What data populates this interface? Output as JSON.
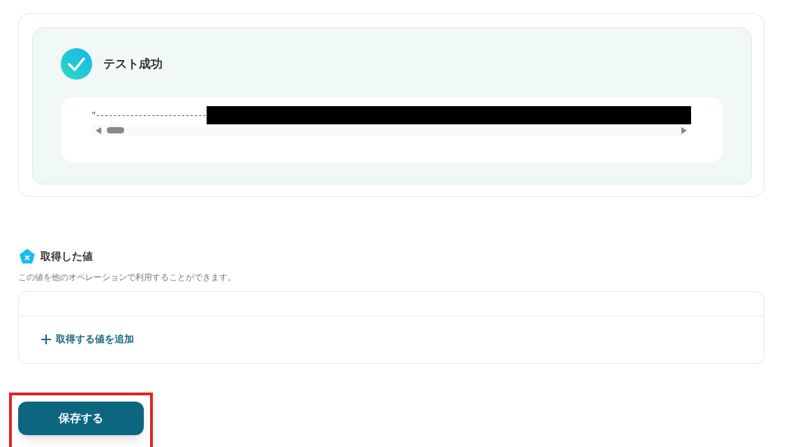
{
  "test_result": {
    "title": "テスト成功",
    "output": "\"--------------------------"
  },
  "acquired_values": {
    "title": "取得した値",
    "description": "この値を他のオペレーションで利用することができます。",
    "add_link": "取得する値を追加"
  },
  "save_button": {
    "label": "保存する"
  }
}
